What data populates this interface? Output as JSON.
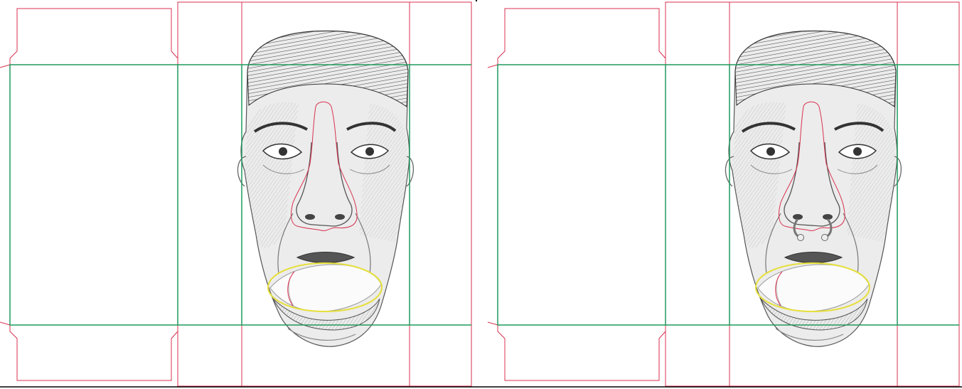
{
  "colors": {
    "cut_line": "#d8324f",
    "fold_line": "#1f9a5c",
    "ellipse": "#e6df3a",
    "pencil": "#3a3a3a",
    "pencil_light": "#8a8a8a",
    "separator": "#000000",
    "background": "#ffffff"
  },
  "panels": [
    {
      "name": "template-left",
      "nose_ring": false
    },
    {
      "name": "template-right",
      "nose_ring": true
    }
  ]
}
